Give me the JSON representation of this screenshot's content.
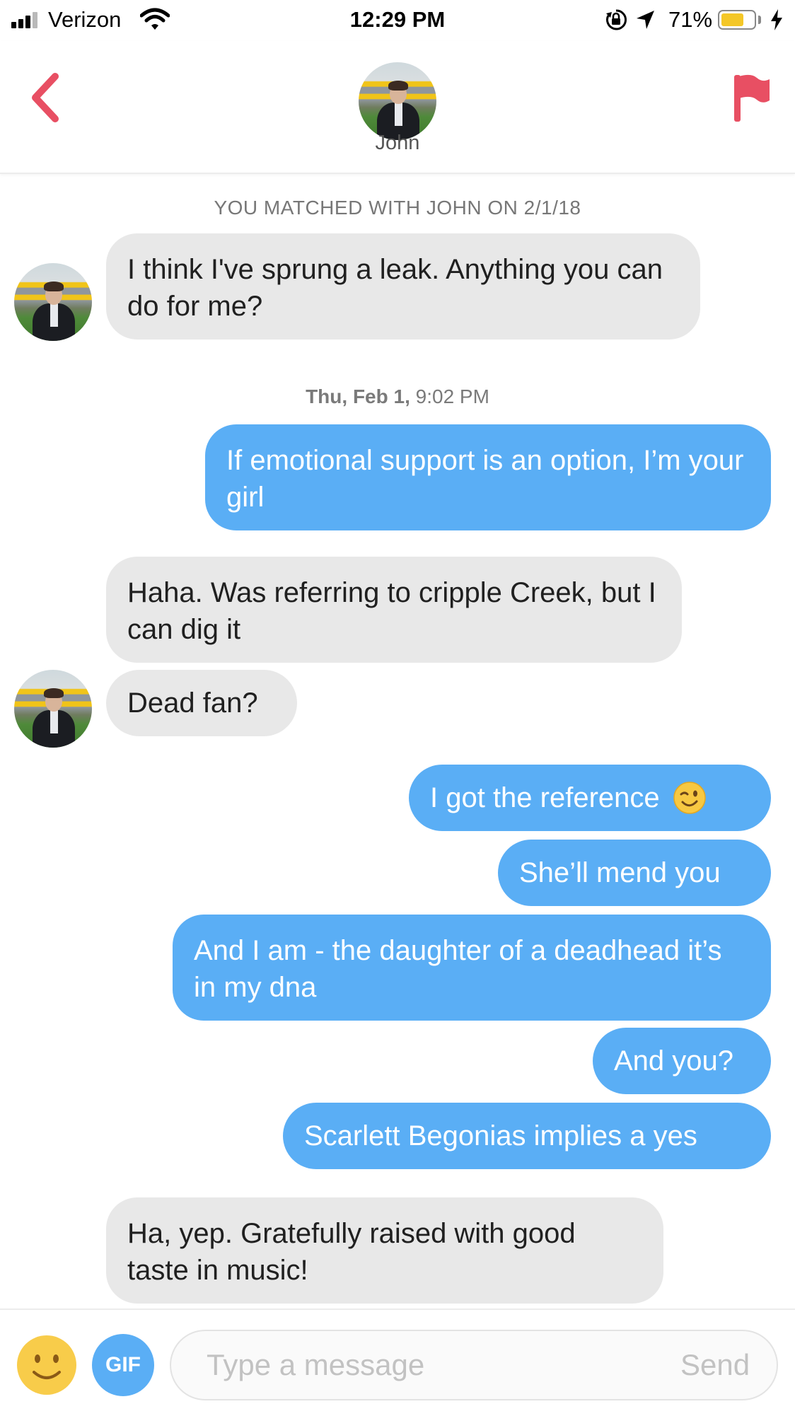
{
  "status_bar": {
    "carrier": "Verizon",
    "time": "12:29 PM",
    "battery_percent": "71%",
    "battery_level": 0.71,
    "battery_color": "#f4c727",
    "icons": [
      "signal-icon",
      "wifi-icon",
      "orientation-lock-icon",
      "location-icon",
      "battery-icon",
      "charging-icon"
    ]
  },
  "header": {
    "name": "John",
    "icons": [
      "back-chevron-icon",
      "flag-icon"
    ],
    "accent_color": "#e84f63"
  },
  "chat": {
    "match_notice": "YOU MATCHED WITH JOHN ON 2/1/18",
    "timestamp_day": "Thu, Feb 1,",
    "timestamp_time": "9:02 PM",
    "messages": [
      {
        "sender": "John",
        "text": "I think I've sprung a leak. Anything you can do for me?"
      },
      {
        "sender": "me",
        "text": "If emotional support is an option, I’m your girl"
      },
      {
        "sender": "John",
        "text": "Haha. Was referring to cripple Creek, but I can dig it"
      },
      {
        "sender": "John",
        "text": "Dead fan?"
      },
      {
        "sender": "me",
        "text": "I got the reference",
        "emoji": "winking-face-icon"
      },
      {
        "sender": "me",
        "text": "She’ll mend you"
      },
      {
        "sender": "me",
        "text": "And I am - the daughter of a deadhead it’s in my dna"
      },
      {
        "sender": "me",
        "text": "And you?"
      },
      {
        "sender": "me",
        "text": "Scarlett Begonias implies a yes"
      },
      {
        "sender": "John",
        "text": "Ha, yep. Gratefully raised with good taste in music!"
      }
    ],
    "incoming_bubble_color": "#e8e8e8",
    "outgoing_bubble_color": "#5aaef5"
  },
  "composer": {
    "gif_label": "GIF",
    "placeholder": "Type a message",
    "value": "",
    "send_label": "Send",
    "icons": [
      "smiley-emoji-icon"
    ]
  }
}
